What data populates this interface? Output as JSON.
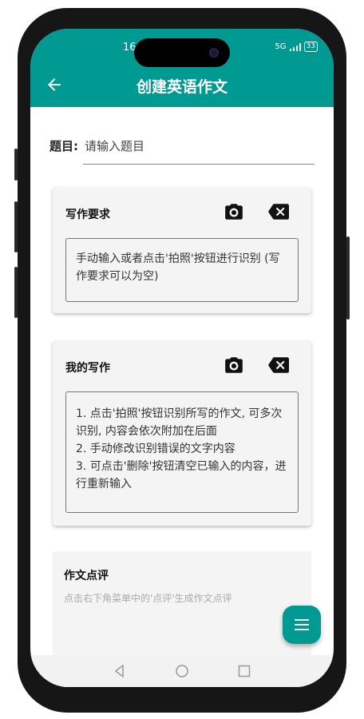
{
  "status_bar": {
    "time": "16",
    "network": "5G",
    "battery": "33"
  },
  "app_bar": {
    "title": "创建英语作文"
  },
  "topic": {
    "label": "题目:",
    "placeholder": "请输入题目"
  },
  "requirements_card": {
    "title": "写作要求",
    "text": "手动输入或者点击'拍照'按钮进行识别 (写作要求可以为空)"
  },
  "my_writing_card": {
    "title": "我的写作",
    "text": "1. 点击'拍照'按钮识别所写的作文, 可多次识别, 内容会依次附加在后面\n2. 手动修改识别错误的文字内容\n3. 可点击'删除'按钮清空已输入的内容，进行重新输入"
  },
  "review_card": {
    "title": "作文点评",
    "hint": "点击右下角菜单中的'点评'生成作文点评"
  },
  "colors": {
    "primary": "#009a93"
  },
  "icons": [
    "back-arrow-icon",
    "camera-icon",
    "backspace-icon",
    "menu-icon"
  ]
}
